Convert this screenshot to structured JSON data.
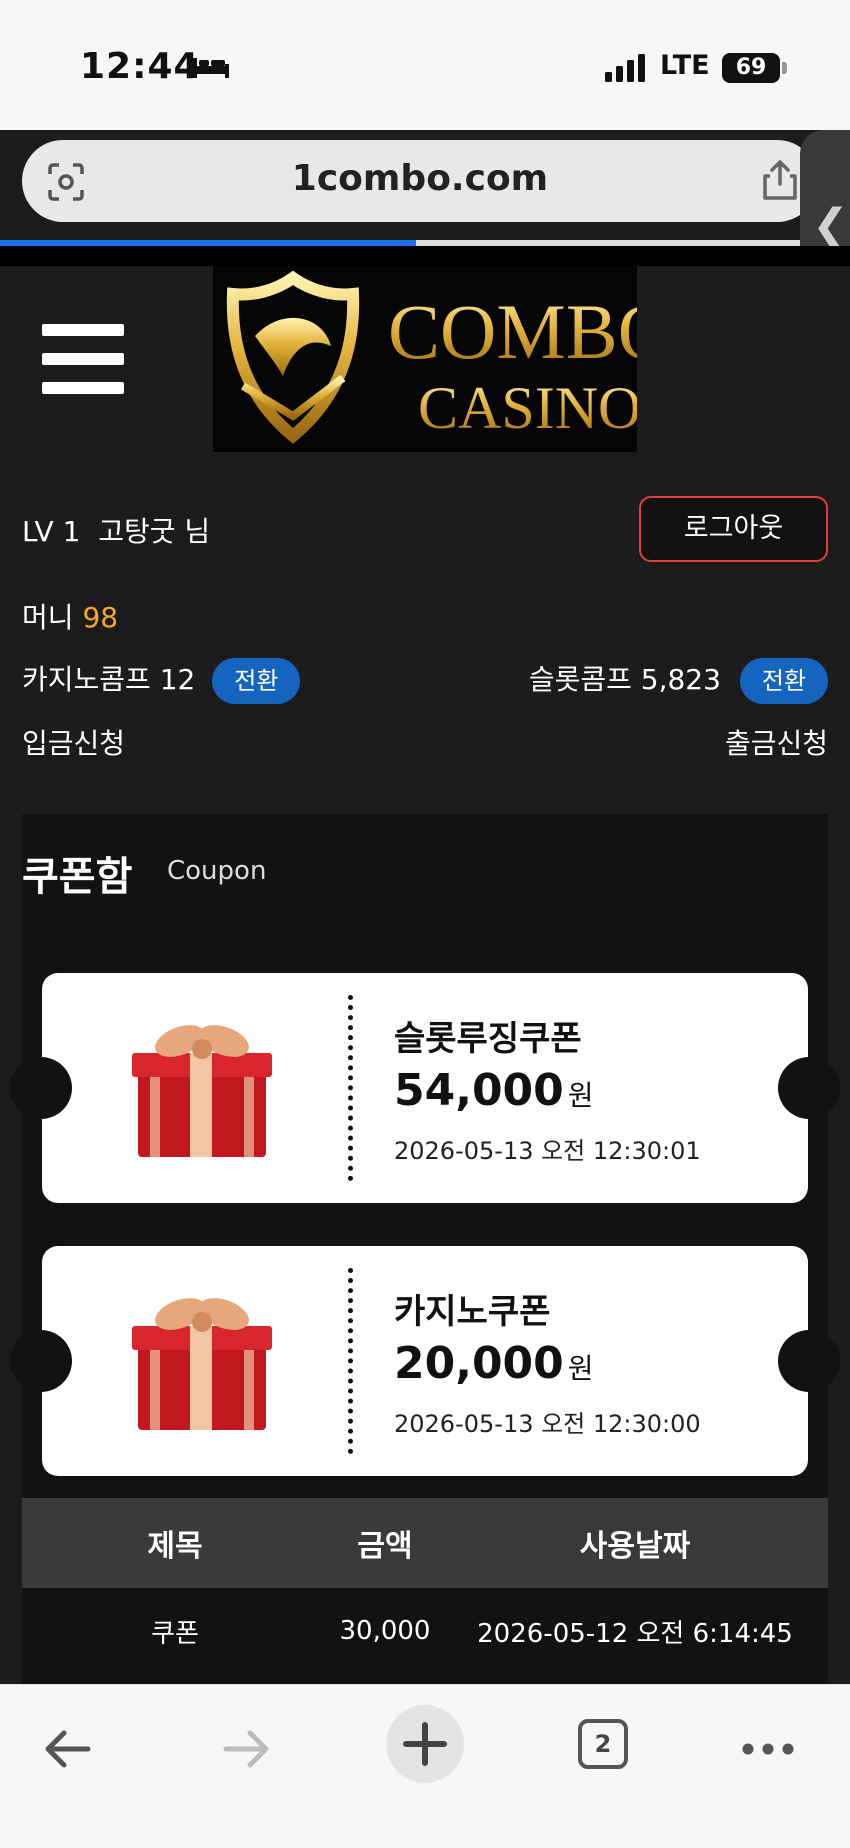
{
  "status_bar": {
    "time": "12:44",
    "network": "LTE",
    "battery": "69"
  },
  "browser": {
    "url": "1combo.com",
    "tab_count": "2",
    "load_progress": 0.52
  },
  "header": {
    "logo_line1": "COMBO",
    "logo_line2": "CASINO"
  },
  "user": {
    "level": "LV 1",
    "name": "고탕굿 님",
    "logout_label": "로그아웃",
    "money_label": "머니",
    "money_value": "98",
    "casino_comp_label": "카지노콤프 12",
    "slot_comp_label": "슬롯콤프 5,823",
    "convert_label": "전환",
    "deposit_label": "입금신청",
    "withdraw_label": "출금신청"
  },
  "coupon_box": {
    "title": "쿠폰함",
    "subtitle": "Coupon",
    "coupons": [
      {
        "name": "슬롯루징쿠폰",
        "amount": "54,000",
        "unit": "원",
        "date": "2026-05-13 오전 12:30:01"
      },
      {
        "name": "카지노쿠폰",
        "amount": "20,000",
        "unit": "원",
        "date": "2026-05-13 오전 12:30:00"
      }
    ]
  },
  "history": {
    "columns": [
      "제목",
      "금액",
      "사용날짜"
    ],
    "rows": [
      [
        "쿠폰",
        "30,000",
        "2026-05-12 오전 6:14:45"
      ]
    ]
  },
  "colors": {
    "accent_blue": "#1565c0",
    "money_orange": "#f5a623",
    "logout_border": "#e0403a"
  }
}
